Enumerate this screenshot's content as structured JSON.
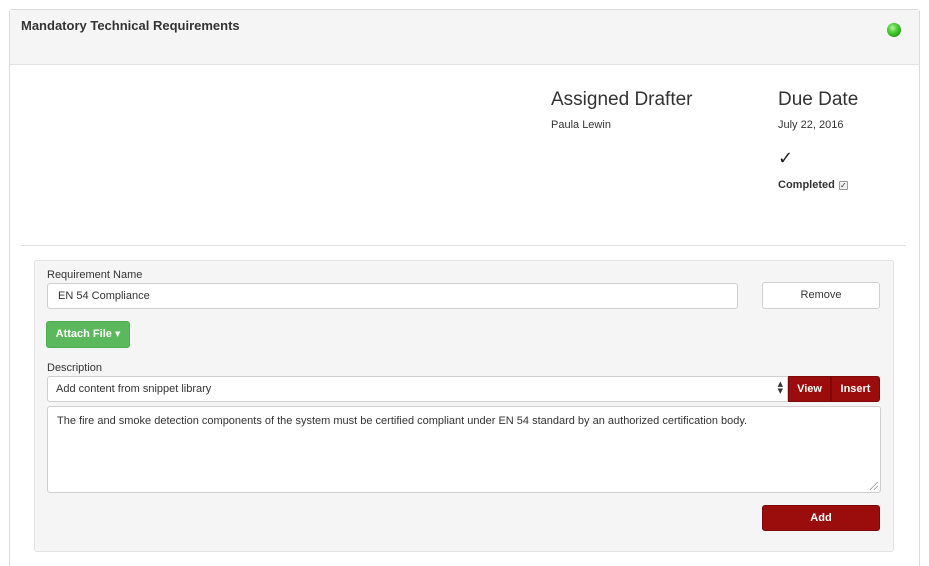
{
  "panel": {
    "title": "Mandatory Technical Requirements",
    "status_color": "#3cbf2a"
  },
  "assignment": {
    "drafter_heading": "Assigned Drafter",
    "drafter_name": "Paula Lewin",
    "due_heading": "Due Date",
    "due_date": "July 22, 2016",
    "check_glyph": "✓",
    "completed_label": "Completed",
    "completed_checked": true
  },
  "requirement": {
    "name_label": "Requirement Name",
    "name_value": "EN 54 Compliance",
    "remove_label": "Remove",
    "attach_label": "Attach File",
    "description_label": "Description",
    "snippet_placeholder": "Add content from snippet library",
    "view_label": "View",
    "insert_label": "Insert",
    "description_text": "The fire and smoke detection components of the system must be certified compliant under EN 54 standard by an authorized certification body.",
    "add_label": "Add"
  },
  "colors": {
    "accent_red": "#9b0c0c",
    "success_green": "#5cb85c"
  }
}
